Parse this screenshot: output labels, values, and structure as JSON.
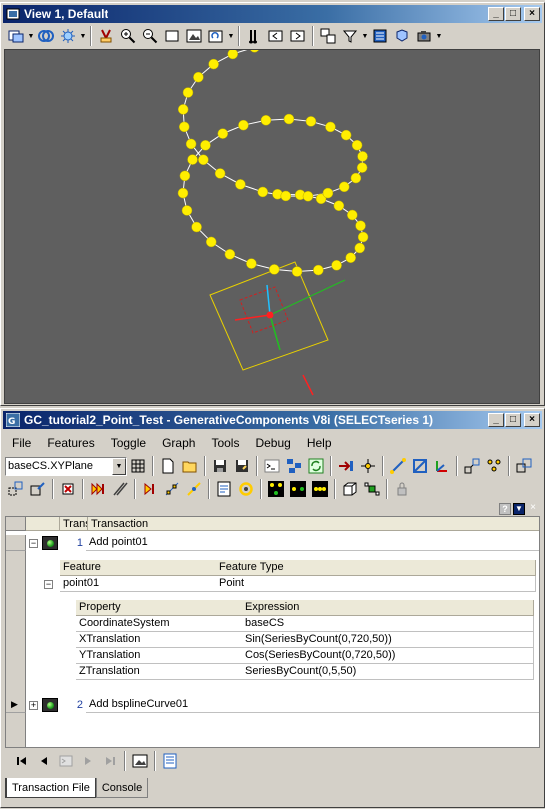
{
  "view_window": {
    "title": "View 1, Default",
    "buttons": {
      "minimize": "_",
      "maximize": "□",
      "close": "×"
    }
  },
  "gc_window": {
    "title": "GC_tutorial2_Point_Test - GenerativeComponents V8i (SELECTseries 1)",
    "buttons": {
      "minimize": "_",
      "maximize": "□",
      "close": "×"
    }
  },
  "menu": [
    "File",
    "Features",
    "Toggle",
    "Graph",
    "Tools",
    "Debug",
    "Help"
  ],
  "plane_combo": {
    "value": "baseCS.XYPlane"
  },
  "grid": {
    "top_header": "Transaction",
    "transactions": [
      {
        "number": "1",
        "label": "Add point01"
      },
      {
        "number": "2",
        "label": "Add bsplineCurve01"
      }
    ],
    "feature_headers": {
      "feature": "Feature",
      "type": "Feature Type"
    },
    "feature_row": {
      "feature": "point01",
      "type": "Point"
    },
    "property_headers": {
      "property": "Property",
      "expression": "Expression"
    },
    "properties": [
      {
        "property": "CoordinateSystem",
        "expression": "baseCS"
      },
      {
        "property": "XTranslation",
        "expression": "Sin(SeriesByCount(0,720,50))"
      },
      {
        "property": "YTranslation",
        "expression": "Cos(SeriesByCount(0,720,50))"
      },
      {
        "property": "ZTranslation",
        "expression": "SeriesByCount(0,5,50)"
      }
    ]
  },
  "tabs": [
    {
      "label": "Transaction File",
      "active": true
    },
    {
      "label": "Console",
      "active": false
    }
  ],
  "colors": {
    "viewport_bg": "#5f5f5f",
    "points": "#ffee00",
    "titlebar": "#0a246a"
  }
}
